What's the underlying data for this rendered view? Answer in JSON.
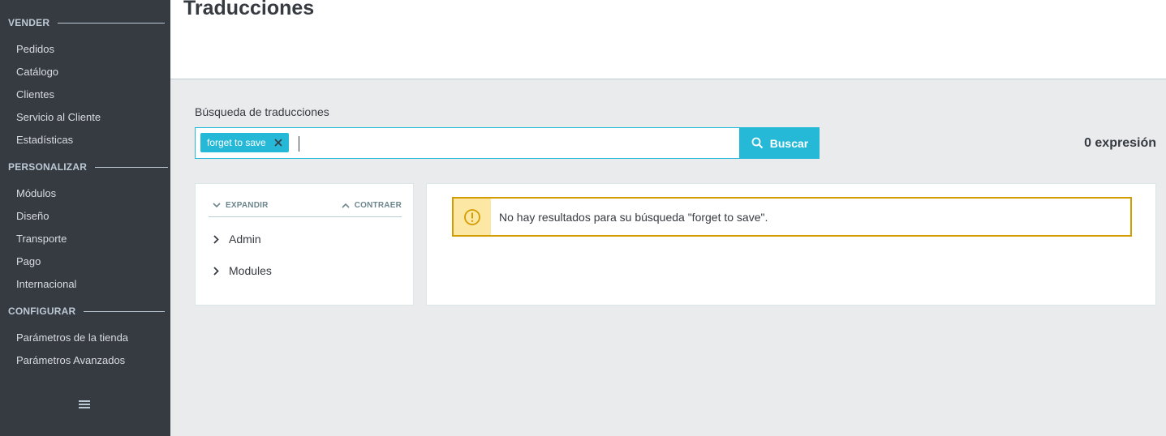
{
  "sidebar": {
    "sections": [
      {
        "title": "VENDER",
        "items": [
          "Pedidos",
          "Catálogo",
          "Clientes",
          "Servicio al Cliente",
          "Estadísticas"
        ]
      },
      {
        "title": "PERSONALIZAR",
        "items": [
          "Módulos",
          "Diseño",
          "Transporte",
          "Pago",
          "Internacional"
        ]
      },
      {
        "title": "CONFIGURAR",
        "items": [
          "Parámetros de la tienda",
          "Parámetros Avanzados"
        ]
      }
    ],
    "menu_toggle_icon": "hamburger-icon"
  },
  "header": {
    "title": "Traducciones"
  },
  "search": {
    "label": "Búsqueda de traducciones",
    "tag": "forget to save",
    "value": "",
    "button_label": "Buscar",
    "count": "0 expresión"
  },
  "tree": {
    "expand_label": "EXPANDIR",
    "collapse_label": "CONTRAER",
    "nodes": [
      "Admin",
      "Modules"
    ]
  },
  "results": {
    "alert_text": "No hay resultados para su búsqueda \"forget to save\".",
    "alert_icon": "warning-icon"
  },
  "colors": {
    "sidebar_bg": "#363a41",
    "accent": "#25b9d7",
    "warning_border": "#d39d00",
    "warning_bg": "#fde7a5"
  }
}
